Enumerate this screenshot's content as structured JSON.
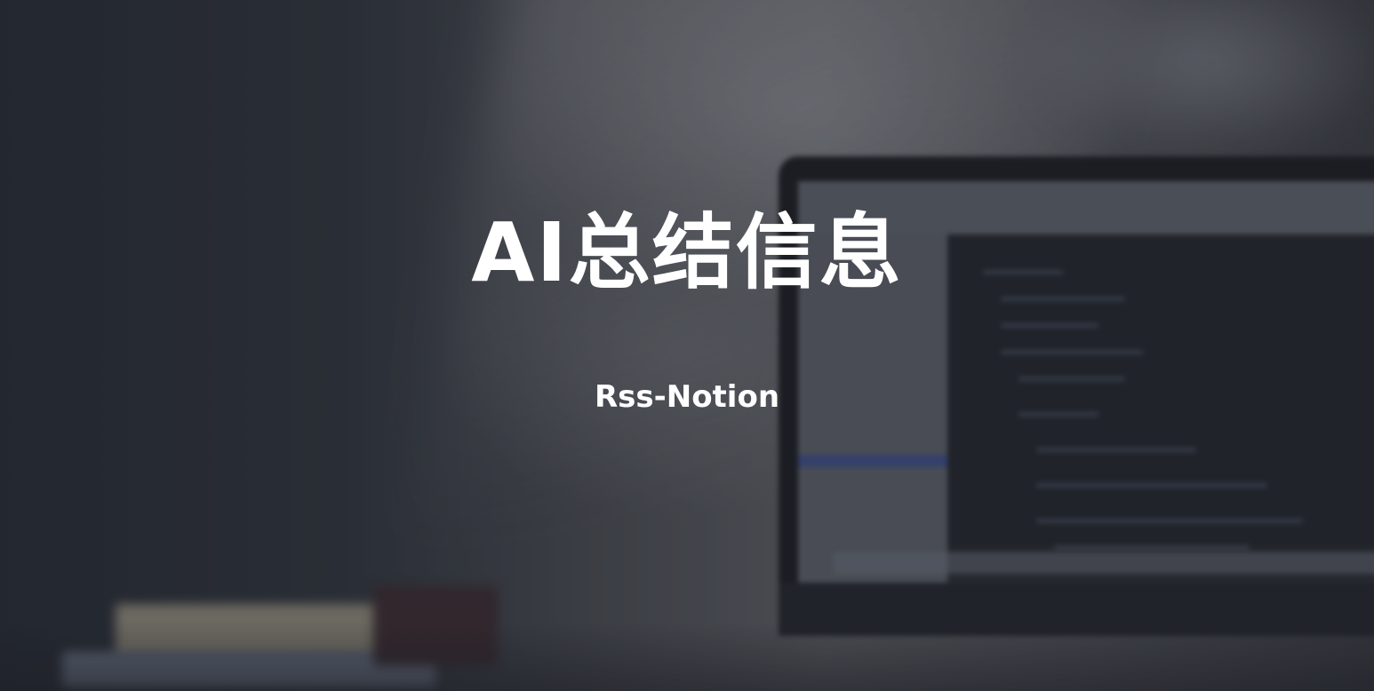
{
  "hero": {
    "title": "AI总结信息",
    "subtitle": "Rss-Notion"
  },
  "colors": {
    "text": "#ffffff",
    "background": "#3a3d44",
    "screen_selection": "#3f4d86"
  }
}
